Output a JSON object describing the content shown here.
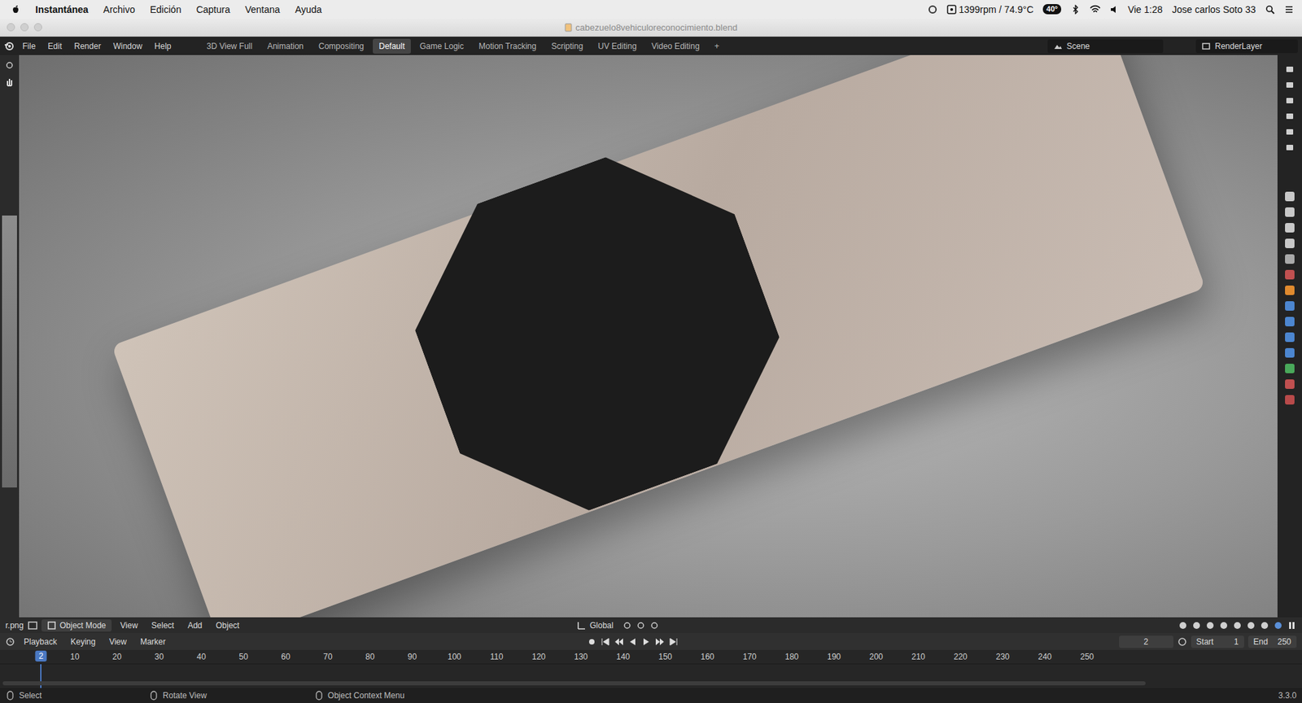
{
  "menubar": {
    "app": "Instantánea",
    "items": [
      "Archivo",
      "Edición",
      "Captura",
      "Ventana",
      "Ayuda"
    ],
    "status": {
      "fan": "1399rpm / 74.9°C",
      "temp": "40°",
      "clock": "Vie 1:28",
      "user": "Jose carlos Soto 33"
    }
  },
  "window": {
    "title": "cabezuelo8vehiculoreconocimiento.blend"
  },
  "topbar": {
    "menus": [
      "File",
      "Edit",
      "Render",
      "Window",
      "Help"
    ],
    "workspaces": [
      {
        "label": "3D View Full",
        "selected": false
      },
      {
        "label": "Animation",
        "selected": false
      },
      {
        "label": "Compositing",
        "selected": false
      },
      {
        "label": "Default",
        "selected": true
      },
      {
        "label": "Game Logic",
        "selected": false
      },
      {
        "label": "Motion Tracking",
        "selected": false
      },
      {
        "label": "Scripting",
        "selected": false
      },
      {
        "label": "UV Editing",
        "selected": false
      },
      {
        "label": "Video Editing",
        "selected": false
      }
    ],
    "add": "+",
    "scene": "Scene",
    "view_layer": "RenderLayer"
  },
  "viewport": {
    "left_editor_label": "r.png",
    "mode": "Object Mode",
    "menus": [
      "View",
      "Select",
      "Add",
      "Object"
    ],
    "orientation": "Global"
  },
  "timeline": {
    "menus": [
      "Playback",
      "Keying",
      "View",
      "Marker"
    ],
    "current_frame": "2",
    "start_label": "Start",
    "start": "1",
    "end_label": "End",
    "end": "250",
    "playhead": "2",
    "ticks": [
      "10",
      "20",
      "30",
      "40",
      "50",
      "60",
      "70",
      "80",
      "90",
      "100",
      "110",
      "120",
      "130",
      "140",
      "150",
      "160",
      "170",
      "180",
      "190",
      "200",
      "210",
      "220",
      "230",
      "240",
      "250"
    ]
  },
  "status_bar": {
    "hints": [
      "Select",
      "Rotate View",
      "Object Context Menu"
    ],
    "version": "3.3.0"
  }
}
